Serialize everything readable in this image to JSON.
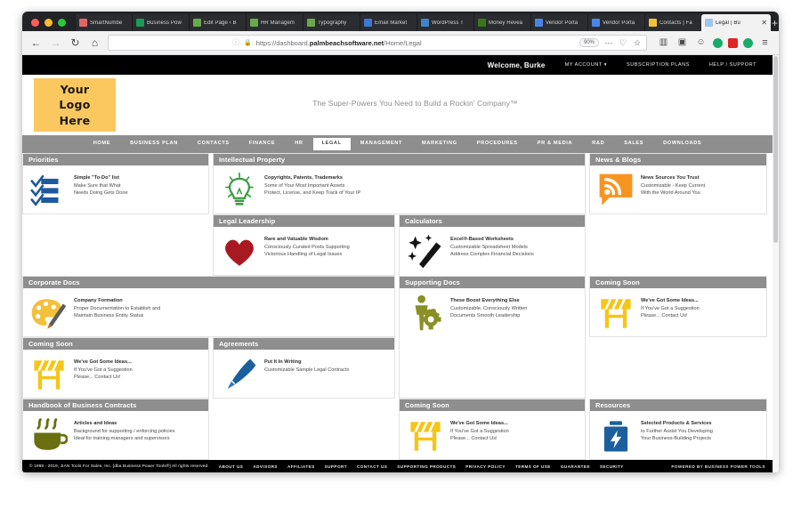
{
  "browser": {
    "tabs": [
      {
        "title": "SmartNumbe",
        "favicon": "#e06666",
        "active": false
      },
      {
        "title": "Business Pow",
        "favicon": "#1a9b57",
        "active": false
      },
      {
        "title": "Edit Page ‹ B",
        "favicon": "#6aa84f",
        "active": false
      },
      {
        "title": "HR Managem",
        "favicon": "#6aa84f",
        "active": false
      },
      {
        "title": "Typography",
        "favicon": "#6aa84f",
        "active": false
      },
      {
        "title": "Email Market",
        "favicon": "#3c78d8",
        "active": false
      },
      {
        "title": "WordPress T",
        "favicon": "#3d85c6",
        "active": false
      },
      {
        "title": "Money Revea",
        "favicon": "#38761d",
        "active": false
      },
      {
        "title": "Vendor Porta",
        "favicon": "#4a86e8",
        "active": false
      },
      {
        "title": "Vendor Porta",
        "favicon": "#4a86e8",
        "active": false
      },
      {
        "title": "Contacts | Fa",
        "favicon": "#f1c232",
        "active": false
      },
      {
        "title": "Legal | Bu",
        "favicon": "#9fc5e8",
        "active": true
      }
    ],
    "tab_close_glyph": "✕",
    "newtab_glyph": "+",
    "nav": {
      "back_glyph": "←",
      "forward_glyph": "→",
      "reload_glyph": "↻",
      "home_glyph": "⌂",
      "shield_glyph": "ⓘ",
      "lock_glyph": "🔒",
      "url_prefix": "https://dashboard.",
      "url_domain": "palmbeachsoftware.net",
      "url_path": "/Home/Legal",
      "url_full": "https://dashboard.palmbeachsoftware.net/Home/Legal",
      "zoom_level": "90%",
      "more_glyph": "⋯",
      "pocket_glyph": "♡",
      "bookmark_glyph": "☆",
      "library_glyph": "▥",
      "sidebar_glyph": "▣",
      "account_glyph": "☺",
      "menu_glyph": "≡"
    },
    "extensions": [
      {
        "name": "extension-green-circle",
        "color": "#1aab6b",
        "shape": "circle"
      },
      {
        "name": "extension-red-square",
        "color": "#e02424",
        "shape": "square"
      },
      {
        "name": "extension-green-circle-2",
        "color": "#1aab6b",
        "shape": "circle"
      }
    ]
  },
  "site": {
    "topbar": {
      "welcome": "Welcome, Burke",
      "links": [
        "MY ACCOUNT ▾",
        "SUBSCRIPTION PLANS",
        "HELP / SUPPORT"
      ]
    },
    "logo": {
      "line1": "Your",
      "line2": "Logo",
      "line3": "Here",
      "color": "#fbc75f"
    },
    "tagline": "The Super-Powers You Need to Build a Rockin' Company™",
    "nav": {
      "items": [
        "HOME",
        "BUSINESS PLAN",
        "CONTACTS",
        "FINANCE",
        "HR",
        "LEGAL",
        "MANAGEMENT",
        "MARKETING",
        "PROCEDURES",
        "PR & MEDIA",
        "R&D",
        "SALES",
        "DOWNLOADS"
      ],
      "active": "LEGAL"
    },
    "cards": [
      {
        "id": "priorities",
        "title": "Priorities",
        "icon": "checklist-icon",
        "heading": "Simple \"To-Do\" list",
        "lines": [
          "Make Sure that What",
          "Needs Doing Gets Done"
        ]
      },
      {
        "id": "intellectual-property",
        "title": "Intellectual Property",
        "icon": "lightbulb-icon",
        "heading": "Copyrights, Patents, Trademarks",
        "lines": [
          "Some of Your Most Important Assets",
          "Protect, License, and Keep Track of Your IP"
        ]
      },
      {
        "id": "news-blogs",
        "title": "News & Blogs",
        "icon": "rss-icon",
        "heading": "News Sources You Trust",
        "lines": [
          "Customizable - Keep Current",
          "With the World Around You"
        ]
      },
      {
        "id": "legal-leadership",
        "title": "Legal Leadership",
        "icon": "heart-icon",
        "heading": "Rare and Valuable Wisdom",
        "lines": [
          "Consciously Curated Posts Supporting",
          "Victorious Handling of Legal Issues"
        ]
      },
      {
        "id": "calculators",
        "title": "Calculators",
        "icon": "magic-wand-icon",
        "heading": "Excel®-Based Worksheets",
        "lines": [
          "Customizable Spreadsheet Models",
          "Address Complex Financial Decisions"
        ]
      },
      {
        "id": "corporate-docs",
        "title": "Corporate Docs",
        "icon": "palette-icon",
        "heading": "Company Formation",
        "lines": [
          "Proper Documentation to Establish and",
          "Maintain Business Entity Status"
        ]
      },
      {
        "id": "supporting-docs",
        "title": "Supporting Docs",
        "icon": "person-gear-icon",
        "heading": "These Boost Everything Else",
        "lines": [
          "Customizable, Consciously Written",
          "Documents Smooth Leadership"
        ]
      },
      {
        "id": "coming-soon-1",
        "title": "Coming Soon",
        "icon": "barricade-icon",
        "heading": "We've Got Some Ideas...",
        "lines": [
          "If You've Got a Suggestion",
          "Please... Contact Us!"
        ]
      },
      {
        "id": "coming-soon-2",
        "title": "Coming Soon",
        "icon": "barricade-icon",
        "heading": "We've Got Some Ideas...",
        "lines": [
          "If You've Got a Suggestion",
          "Please... Contact Us!"
        ]
      },
      {
        "id": "agreements",
        "title": "Agreements",
        "icon": "pen-icon",
        "heading": "Put It In Writing",
        "lines": [
          "Customizable Sample Legal Contracts"
        ]
      },
      {
        "id": "handbook",
        "title": "Handbook of Business Contracts",
        "icon": "coffee-cup-icon",
        "heading": "Articles and Ideas",
        "lines": [
          "Background for supporting / enforcing policies",
          "Ideal for training managers and supervisors"
        ]
      },
      {
        "id": "coming-soon-3",
        "title": "Coming Soon",
        "icon": "barricade-icon",
        "heading": "We've Got Some Ideas...",
        "lines": [
          "If You've Got a Suggestion",
          "Please... Contact Us!"
        ]
      },
      {
        "id": "resources",
        "title": "Resources",
        "icon": "battery-bolt-icon",
        "heading": "Selected Products & Services",
        "lines": [
          "to Further Assist You Developing",
          "Your Business-Building Projects"
        ]
      }
    ],
    "footer": {
      "copyright": "© 1998 - 2019, JIAN Tools For Sales, Inc. [dba Business Power Tools®] All rights reserved.",
      "links": [
        "ABOUT US",
        "ADVISORS",
        "AFFILIATES",
        "SUPPORT",
        "CONTACT US",
        "SUPPORTING PRODUCTS",
        "PRIVACY POLICY",
        "TERMS OF USE",
        "GUARANTEE",
        "SECURITY"
      ],
      "powered_by": "POWERED BY BUSINESS POWER TOOLS"
    }
  }
}
